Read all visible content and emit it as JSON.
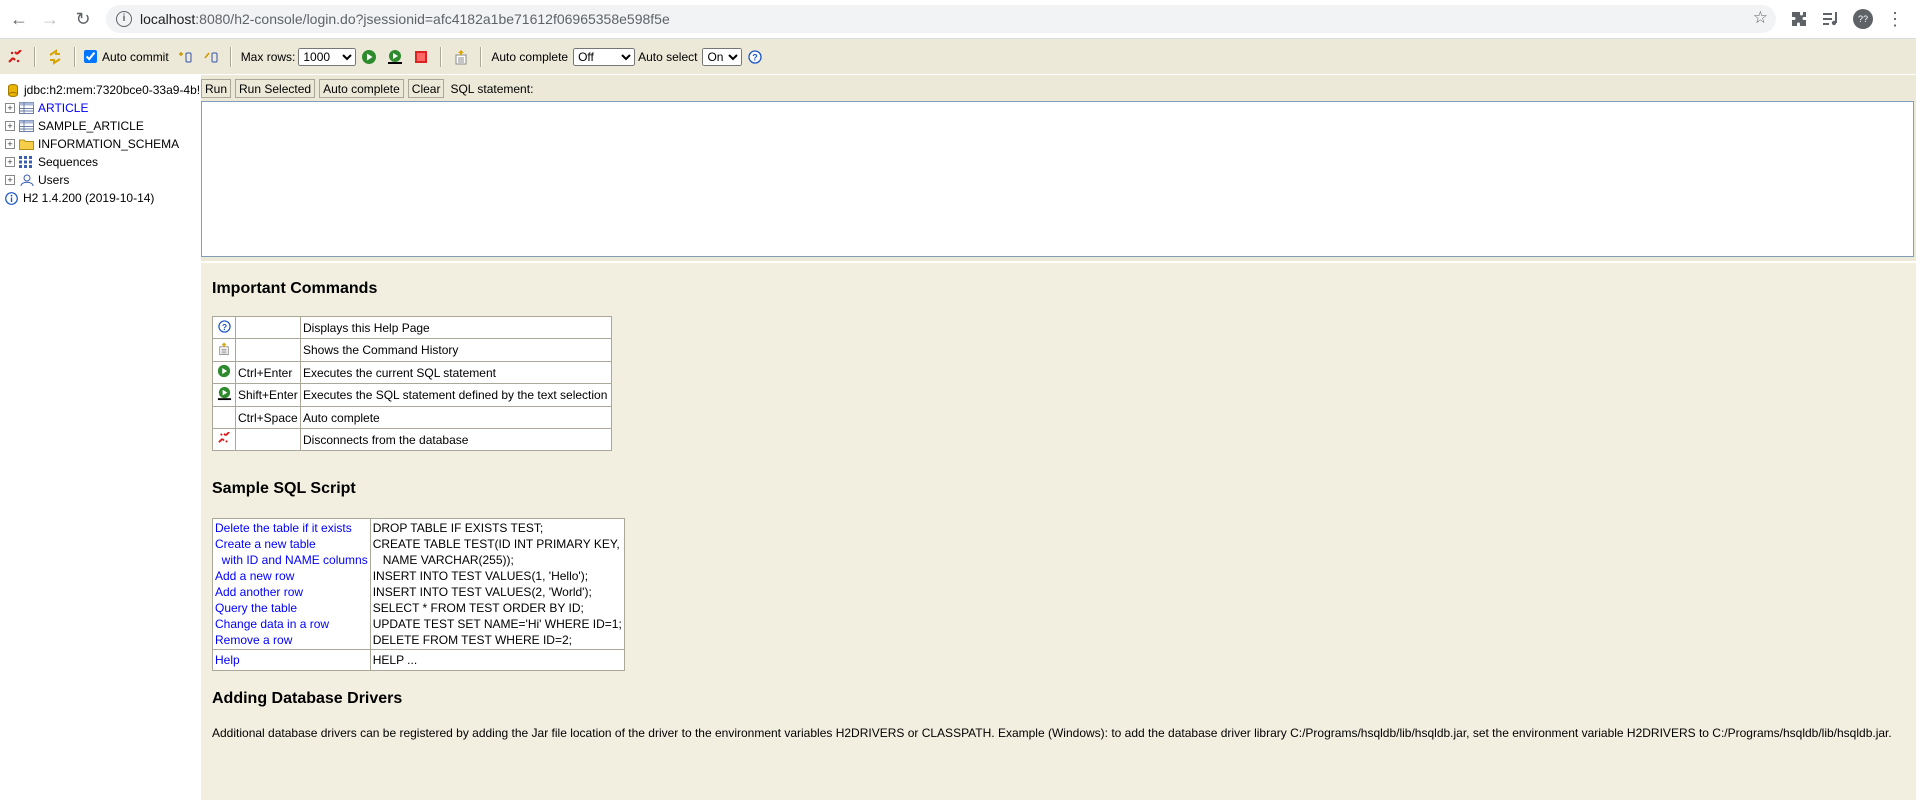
{
  "browser": {
    "url_host": "localhost",
    "url_rest": ":8080/h2-console/login.do?jsessionid=afc4182a1be71612f06965358e598f5e",
    "profile_initials": "??"
  },
  "toolbar": {
    "auto_commit_label": "Auto commit",
    "auto_commit_checked": true,
    "max_rows_label": "Max rows:",
    "max_rows_value": "1000",
    "auto_complete_label": "Auto complete",
    "auto_complete_value": "Off",
    "auto_select_label": "Auto select",
    "auto_select_value": "On"
  },
  "tree": {
    "connection": "jdbc:h2:mem:7320bce0-33a9-4b!",
    "items": [
      {
        "label": "ARTICLE",
        "link": true,
        "icon": "table-icon"
      },
      {
        "label": "SAMPLE_ARTICLE",
        "link": false,
        "icon": "table-icon"
      },
      {
        "label": "INFORMATION_SCHEMA",
        "link": false,
        "icon": "folder-icon"
      },
      {
        "label": "Sequences",
        "link": false,
        "icon": "sequences-icon"
      },
      {
        "label": "Users",
        "link": false,
        "icon": "users-icon"
      }
    ],
    "version": "H2 1.4.200 (2019-10-14)"
  },
  "query": {
    "run": "Run",
    "run_selected": "Run Selected",
    "auto_complete": "Auto complete",
    "clear": "Clear",
    "sql_label": "SQL statement:",
    "sql_text": ""
  },
  "help": {
    "important_title": "Important Commands",
    "commands": [
      {
        "icon": "help-icon",
        "key": "",
        "desc": "Displays this Help Page"
      },
      {
        "icon": "history-icon",
        "key": "",
        "desc": "Shows the Command History"
      },
      {
        "icon": "run-icon",
        "key": "Ctrl+Enter",
        "desc": "Executes the current SQL statement"
      },
      {
        "icon": "run-selected-icon",
        "key": "Shift+Enter",
        "desc": "Executes the SQL statement defined by the text selection"
      },
      {
        "icon": "",
        "key": "Ctrl+Space",
        "desc": "Auto complete"
      },
      {
        "icon": "disconnect-icon",
        "key": "",
        "desc": "Disconnects from the database"
      }
    ],
    "sample_title": "Sample SQL Script",
    "sample": [
      {
        "link": "Delete the table if it exists",
        "sql": "DROP TABLE IF EXISTS TEST;"
      },
      {
        "link": "Create a new table",
        "sql": "CREATE TABLE TEST(ID INT PRIMARY KEY,"
      },
      {
        "link": "  with ID and NAME columns",
        "sql": "   NAME VARCHAR(255));"
      },
      {
        "link": "Add a new row",
        "sql": "INSERT INTO TEST VALUES(1, 'Hello');"
      },
      {
        "link": "Add another row",
        "sql": "INSERT INTO TEST VALUES(2, 'World');"
      },
      {
        "link": "Query the table",
        "sql": "SELECT * FROM TEST ORDER BY ID;"
      },
      {
        "link": "Change data in a row",
        "sql": "UPDATE TEST SET NAME='Hi' WHERE ID=1;"
      },
      {
        "link": "Remove a row",
        "sql": "DELETE FROM TEST WHERE ID=2;"
      }
    ],
    "help_link": "Help",
    "help_sql": "HELP ...",
    "drivers_title": "Adding Database Drivers",
    "drivers_text": "Additional database drivers can be registered by adding the Jar file location of the driver to the environment variables H2DRIVERS or CLASSPATH. Example (Windows): to add the database driver library C:/Programs/hsqldb/lib/hsqldb.jar, set the environment variable H2DRIVERS to C:/Programs/hsqldb/lib/hsqldb.jar."
  }
}
